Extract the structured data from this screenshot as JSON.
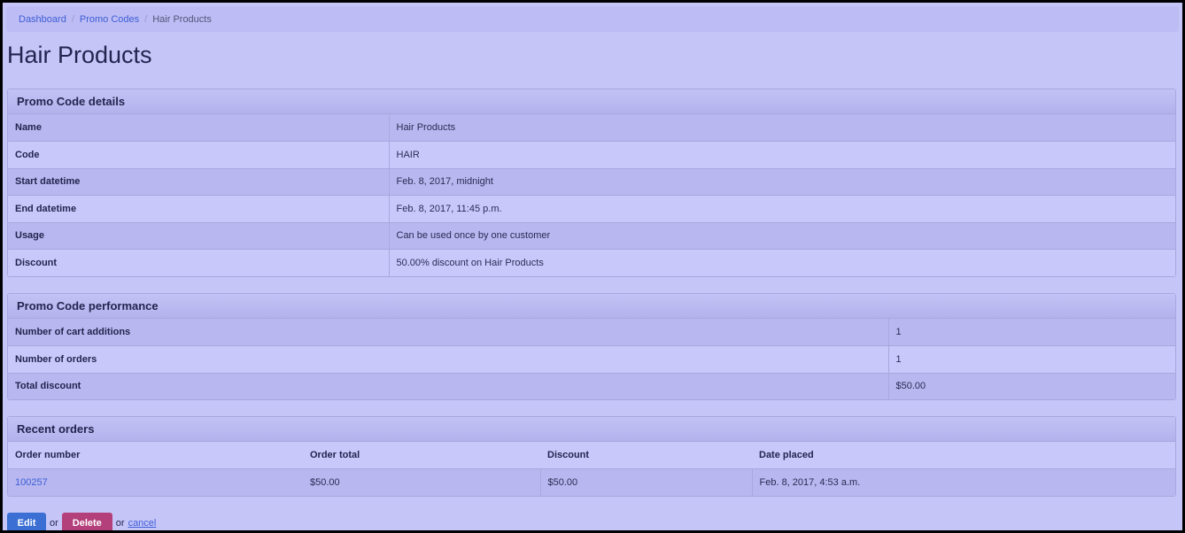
{
  "breadcrumb": {
    "dashboard": "Dashboard",
    "promo_codes": "Promo Codes",
    "current": "Hair Products",
    "separator": "/"
  },
  "page_title": "Hair Products",
  "details": {
    "heading": "Promo Code details",
    "rows": [
      {
        "label": "Name",
        "value": "Hair Products"
      },
      {
        "label": "Code",
        "value": "HAIR"
      },
      {
        "label": "Start datetime",
        "value": "Feb. 8, 2017, midnight"
      },
      {
        "label": "End datetime",
        "value": "Feb. 8, 2017, 11:45 p.m."
      },
      {
        "label": "Usage",
        "value": "Can be used once by one customer"
      },
      {
        "label": "Discount",
        "value": "50.00% discount on Hair Products"
      }
    ]
  },
  "performance": {
    "heading": "Promo Code performance",
    "rows": [
      {
        "label": "Number of cart additions",
        "value": "1"
      },
      {
        "label": "Number of orders",
        "value": "1"
      },
      {
        "label": "Total discount",
        "value": "$50.00"
      }
    ]
  },
  "recent_orders": {
    "heading": "Recent orders",
    "columns": [
      "Order number",
      "Order total",
      "Discount",
      "Date placed"
    ],
    "rows": [
      {
        "order_number": "100257",
        "order_total": "$50.00",
        "discount": "$50.00",
        "date_placed": "Feb. 8, 2017, 4:53 a.m."
      }
    ]
  },
  "actions": {
    "edit": "Edit",
    "or1": "or",
    "delete": "Delete",
    "or2": "or",
    "cancel": "cancel"
  }
}
